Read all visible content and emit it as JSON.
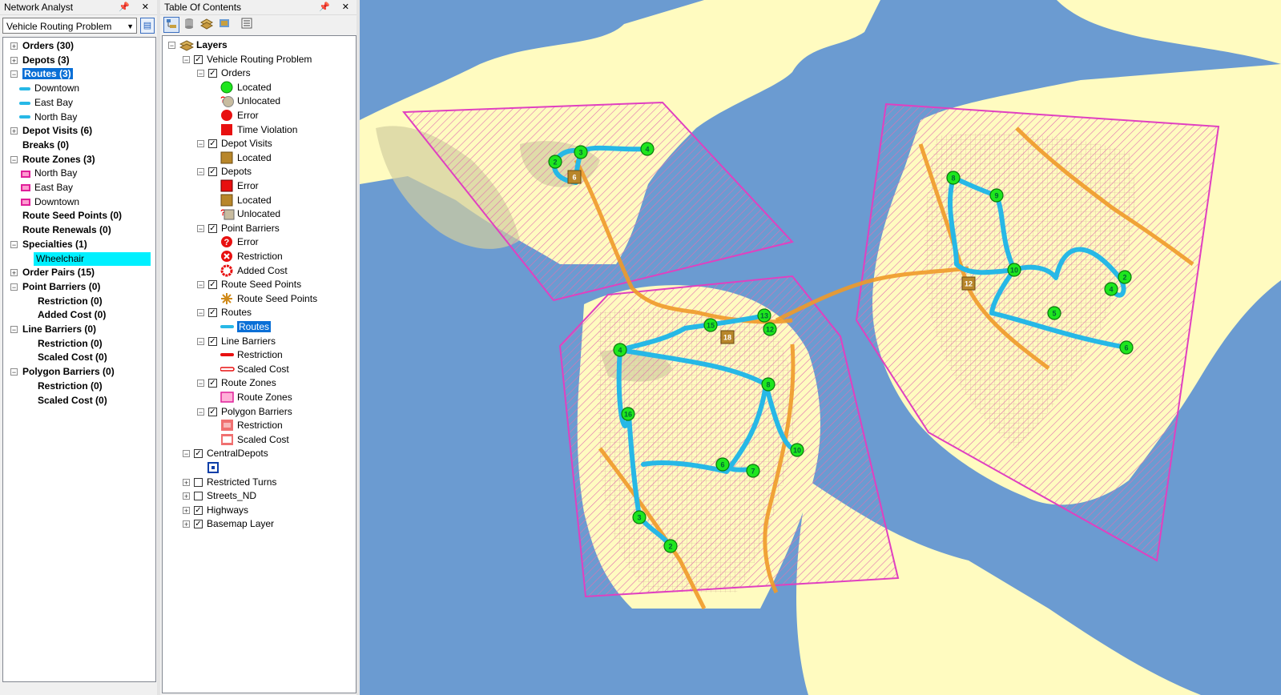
{
  "network_analyst": {
    "title": "Network Analyst",
    "title_icons": "📌 ✕",
    "solver": "Vehicle Routing Problem",
    "tree": [
      {
        "label": "Orders (30)",
        "bold": true,
        "expander": "+"
      },
      {
        "label": "Depots (3)",
        "bold": true,
        "expander": "+"
      },
      {
        "label": "Routes (3)",
        "bold": true,
        "expander": "−",
        "selected": true
      },
      {
        "label": "Downtown",
        "sym": "line"
      },
      {
        "label": "East Bay",
        "sym": "line"
      },
      {
        "label": "North Bay",
        "sym": "line"
      },
      {
        "label": "Depot Visits (6)",
        "bold": true,
        "expander": "+"
      },
      {
        "label": "Breaks (0)",
        "bold": true
      },
      {
        "label": "Route Zones (3)",
        "bold": true,
        "expander": "−"
      },
      {
        "label": "North Bay",
        "sym": "zone"
      },
      {
        "label": "East Bay",
        "sym": "zone"
      },
      {
        "label": "Downtown",
        "sym": "zone"
      },
      {
        "label": "Route Seed Points (0)",
        "bold": true
      },
      {
        "label": "Route Renewals (0)",
        "bold": true
      },
      {
        "label": "Specialties (1)",
        "bold": true,
        "expander": "−"
      },
      {
        "label": "Wheelchair",
        "highlight": true
      },
      {
        "label": "Order Pairs (15)",
        "bold": true,
        "expander": "+"
      },
      {
        "label": "Point Barriers (0)",
        "bold": true,
        "expander": "−"
      },
      {
        "label": "Restriction (0)",
        "bold": true,
        "sub": true
      },
      {
        "label": "Added Cost (0)",
        "bold": true,
        "sub": true
      },
      {
        "label": "Line Barriers (0)",
        "bold": true,
        "expander": "−"
      },
      {
        "label": "Restriction (0)",
        "bold": true,
        "sub": true
      },
      {
        "label": "Scaled Cost (0)",
        "bold": true,
        "sub": true
      },
      {
        "label": "Polygon Barriers (0)",
        "bold": true,
        "expander": "−"
      },
      {
        "label": "Restriction (0)",
        "bold": true,
        "sub": true
      },
      {
        "label": "Scaled Cost (0)",
        "bold": true,
        "sub": true
      }
    ]
  },
  "toc": {
    "title": "Table Of Contents",
    "title_icons": "📌 ✕",
    "tree": [
      {
        "label": "Layers",
        "level": 0,
        "expander": "−",
        "bold": true,
        "icon": "layers"
      },
      {
        "label": "Vehicle Routing Problem",
        "level": 1,
        "expander": "−",
        "check": true
      },
      {
        "label": "Orders",
        "level": 2,
        "expander": "−",
        "check": true
      },
      {
        "label": "Located",
        "level": 3,
        "sym": "green-circle"
      },
      {
        "label": "Unlocated",
        "level": 3,
        "sym": "q-tan-circle"
      },
      {
        "label": "Error",
        "level": 3,
        "sym": "red-circle"
      },
      {
        "label": "Time Violation",
        "level": 3,
        "sym": "red-square"
      },
      {
        "label": "Depot Visits",
        "level": 2,
        "expander": "−",
        "check": true
      },
      {
        "label": "Located",
        "level": 3,
        "sym": "brown-square"
      },
      {
        "label": "Depots",
        "level": 2,
        "expander": "−",
        "check": true
      },
      {
        "label": "Error",
        "level": 3,
        "sym": "red-square-outline"
      },
      {
        "label": "Located",
        "level": 3,
        "sym": "brown-square"
      },
      {
        "label": "Unlocated",
        "level": 3,
        "sym": "q-tan-square"
      },
      {
        "label": "Point Barriers",
        "level": 2,
        "expander": "−",
        "check": true
      },
      {
        "label": "Error",
        "level": 3,
        "sym": "red-question"
      },
      {
        "label": "Restriction",
        "level": 3,
        "sym": "red-x"
      },
      {
        "label": "Added Cost",
        "level": 3,
        "sym": "red-ring"
      },
      {
        "label": "Route Seed Points",
        "level": 2,
        "expander": "−",
        "check": true
      },
      {
        "label": "Route Seed Points",
        "level": 3,
        "sym": "star"
      },
      {
        "label": "Routes",
        "level": 2,
        "expander": "−",
        "check": true
      },
      {
        "label": "Routes",
        "level": 3,
        "sym": "blue-line",
        "selected": true
      },
      {
        "label": "Line Barriers",
        "level": 2,
        "expander": "−",
        "check": true
      },
      {
        "label": "Restriction",
        "level": 3,
        "sym": "red-line"
      },
      {
        "label": "Scaled Cost",
        "level": 3,
        "sym": "red-line-outline"
      },
      {
        "label": "Route Zones",
        "level": 2,
        "expander": "−",
        "check": true
      },
      {
        "label": "Route Zones",
        "level": 3,
        "sym": "pink-zone"
      },
      {
        "label": "Polygon Barriers",
        "level": 2,
        "expander": "−",
        "check": true
      },
      {
        "label": "Restriction",
        "level": 3,
        "sym": "poly-restrict"
      },
      {
        "label": "Scaled Cost",
        "level": 3,
        "sym": "poly-scaled"
      },
      {
        "label": "CentralDepots",
        "level": 1,
        "expander": "−",
        "check": true
      },
      {
        "label": "",
        "level": 2,
        "sym": "blue-depot"
      },
      {
        "label": "Restricted Turns",
        "level": 1,
        "expander": "+",
        "check": false
      },
      {
        "label": "Streets_ND",
        "level": 1,
        "expander": "+",
        "check": false
      },
      {
        "label": "Highways",
        "level": 1,
        "expander": "+",
        "check": true
      },
      {
        "label": "Basemap Layer",
        "level": 1,
        "expander": "+",
        "check": true
      }
    ]
  },
  "map": {
    "colors": {
      "water": "#6b9bd1",
      "land": "#fffbc0",
      "urban": "#f3d9c8",
      "park": "#d3cfa0",
      "route": "#27b8e6",
      "zone": "#e040c0",
      "highway": "#f09a28",
      "order": "#1ee61e",
      "depot": "#b8862a"
    },
    "stops": [
      {
        "label": "2"
      },
      {
        "label": "3"
      },
      {
        "label": "4"
      },
      {
        "label": "8"
      },
      {
        "label": "9"
      },
      {
        "label": "10"
      },
      {
        "label": "2"
      },
      {
        "label": "4"
      },
      {
        "label": "5"
      },
      {
        "label": "6"
      },
      {
        "label": "13"
      },
      {
        "label": "15"
      },
      {
        "label": "12"
      },
      {
        "label": "4"
      },
      {
        "label": "8"
      },
      {
        "label": "16"
      },
      {
        "label": "10"
      },
      {
        "label": "6"
      },
      {
        "label": "7"
      },
      {
        "label": "3"
      },
      {
        "label": "2"
      }
    ],
    "depots": [
      {
        "label": "6"
      },
      {
        "label": "12"
      },
      {
        "label": "18"
      }
    ]
  }
}
